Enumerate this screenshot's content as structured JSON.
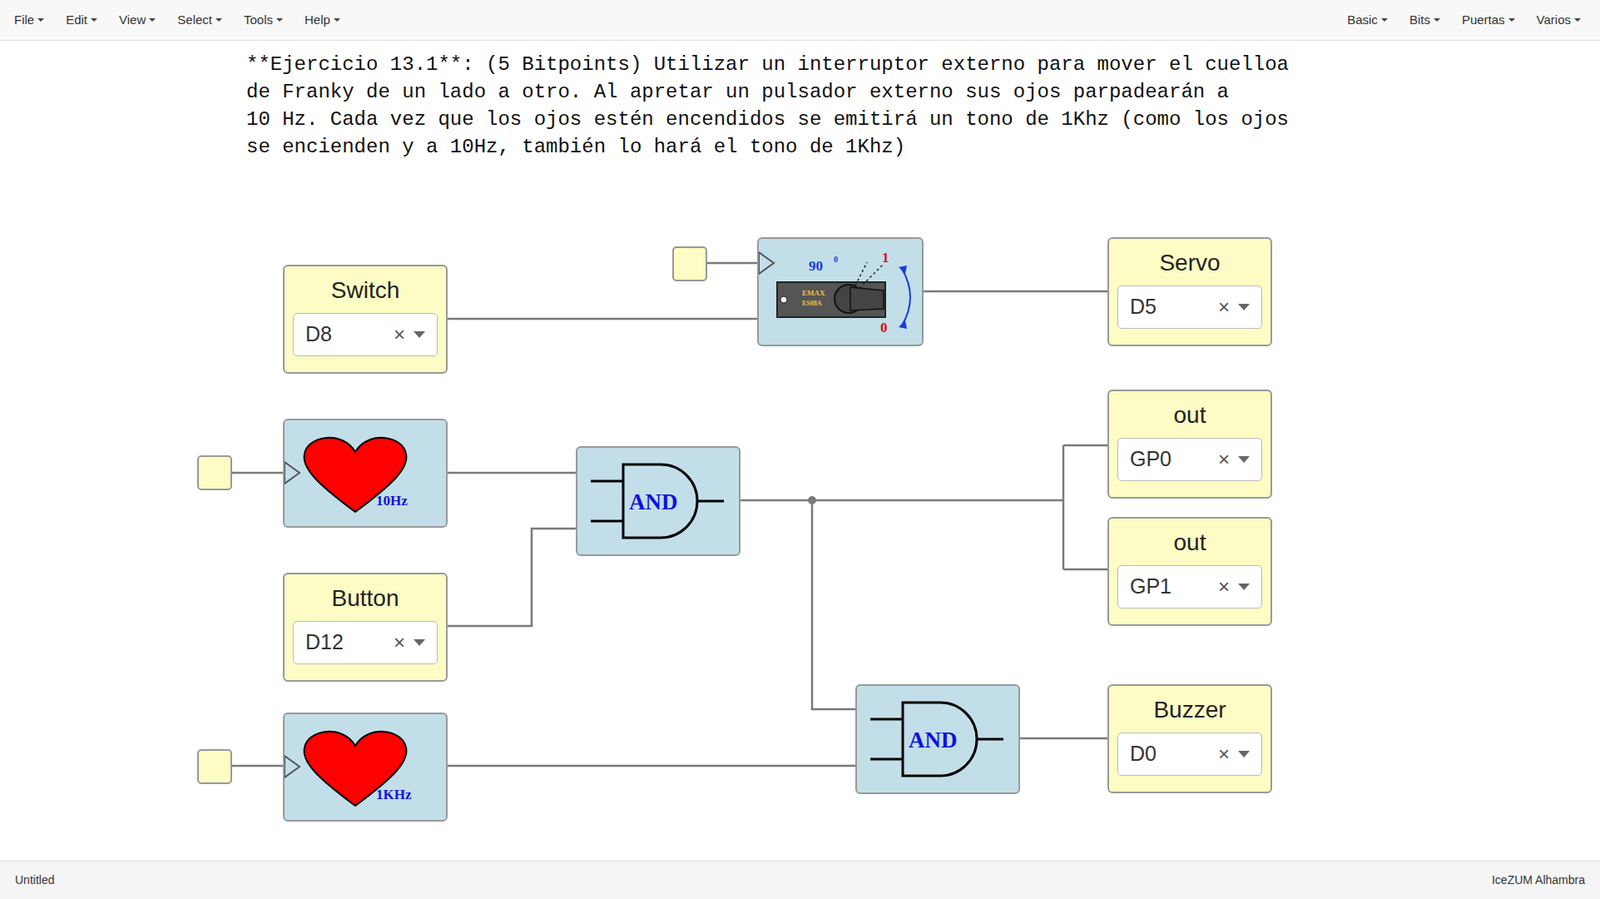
{
  "menu": {
    "left": [
      "File",
      "Edit",
      "View",
      "Select",
      "Tools",
      "Help"
    ],
    "right": [
      "Basic",
      "Bits",
      "Puertas",
      "Varios"
    ]
  },
  "exercise": {
    "lines": [
      "**Ejercicio 13.1**: (5 Bitpoints) Utilizar un interruptor externo para mover el cuelloa",
      "de Franky de un lado a otro. Al apretar un pulsador externo sus ojos parpadearán a",
      "10 Hz. Cada vez que los ojos estén encendidos se emitirá un tono de 1Khz (como los ojos",
      "se encienden y a 10Hz, también lo hará el tono de 1Khz)"
    ]
  },
  "blocks": [
    {
      "kind": "io",
      "label": "Switch",
      "value": "D8",
      "clear": "×"
    },
    {
      "kind": "servo",
      "angle": "90",
      "degree": "0",
      "max": "1",
      "min": "0",
      "brand": "EMAX",
      "model": "ES08A"
    },
    {
      "kind": "io",
      "label": "Servo",
      "value": "D5",
      "clear": "×"
    },
    {
      "kind": "heart",
      "frequency": "10Hz"
    },
    {
      "kind": "and",
      "label": "AND"
    },
    {
      "kind": "io",
      "label": "Button",
      "value": "D12",
      "clear": "×"
    },
    {
      "kind": "io",
      "label": "out",
      "value": "GP0",
      "clear": "×"
    },
    {
      "kind": "io",
      "label": "out",
      "value": "GP1",
      "clear": "×"
    },
    {
      "kind": "and",
      "label": "AND"
    },
    {
      "kind": "io",
      "label": "Buzzer",
      "value": "D0",
      "clear": "×"
    },
    {
      "kind": "heart",
      "frequency": "1KHz"
    }
  ],
  "status_bar": {
    "left": "Untitled",
    "right": "IceZUM Alhambra"
  }
}
